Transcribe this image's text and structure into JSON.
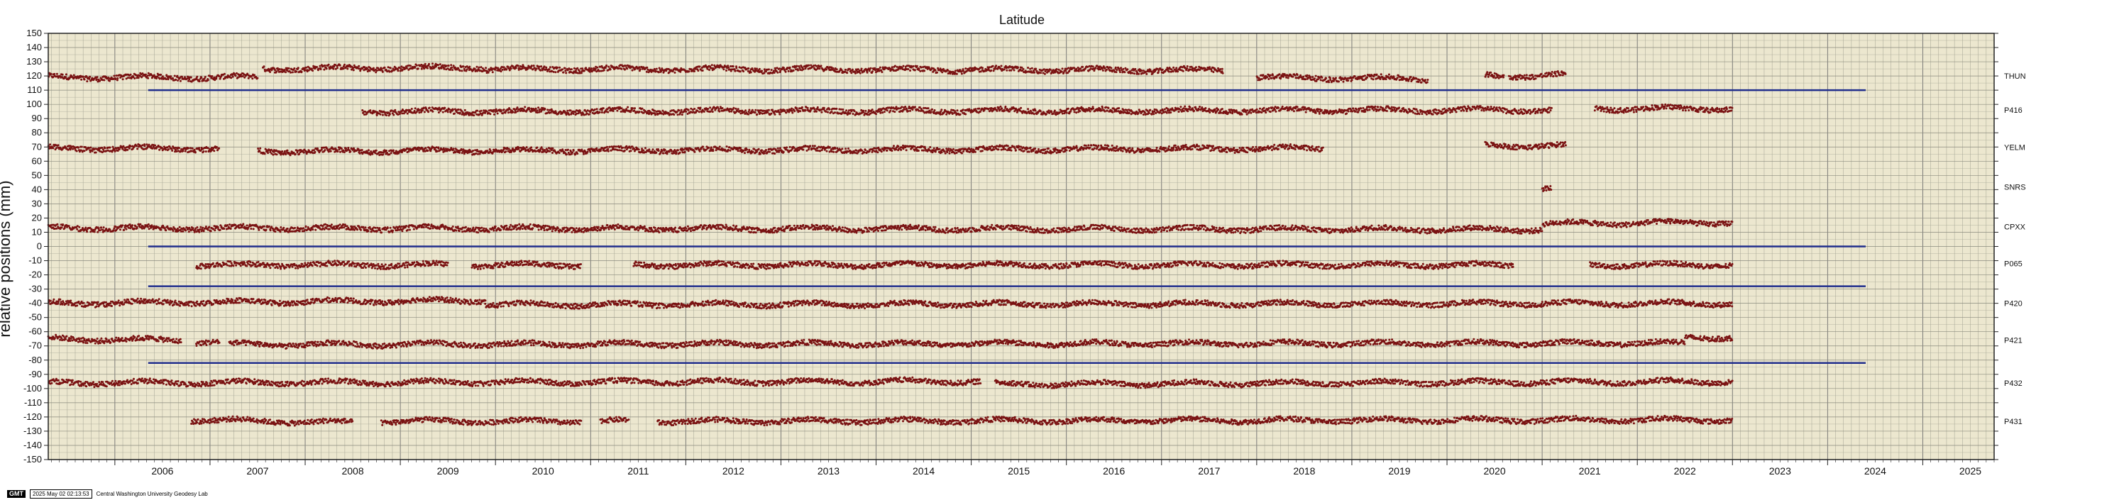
{
  "chart_data": {
    "type": "scatter",
    "title": "Latitude",
    "ylabel": "relative positions (mm)",
    "xlabel": "",
    "xlim": [
      2005.3,
      2025.75
    ],
    "ylim": [
      -150,
      150
    ],
    "y_ticks": [
      -150,
      -140,
      -130,
      -120,
      -110,
      -100,
      -90,
      -80,
      -70,
      -60,
      -50,
      -40,
      -30,
      -20,
      -10,
      0,
      10,
      20,
      30,
      40,
      50,
      60,
      70,
      80,
      90,
      100,
      110,
      120,
      130,
      140,
      150
    ],
    "x_ticks": [
      2006,
      2007,
      2008,
      2009,
      2010,
      2011,
      2012,
      2013,
      2014,
      2015,
      2016,
      2017,
      2018,
      2019,
      2020,
      2021,
      2022,
      2023,
      2024,
      2025
    ],
    "x_tick_labels": [
      "2006",
      "2007",
      "2008",
      "2009",
      "2010",
      "2011",
      "2012",
      "2013",
      "2014",
      "2015",
      "2016",
      "2017",
      "2018",
      "2019",
      "2020",
      "2021",
      "2022",
      "2023",
      "2024",
      "2025"
    ],
    "grid": true,
    "background": "#ece7cf",
    "point_color": "#7a1212",
    "ref_line_color": "#1f2d8c",
    "reference_lines": [
      {
        "y": 110,
        "x": [
          2006.35,
          2024.4
        ]
      },
      {
        "y": 0,
        "x": [
          2006.35,
          2024.4
        ]
      },
      {
        "y": -28,
        "x": [
          2006.35,
          2024.4
        ]
      },
      {
        "y": -82,
        "x": [
          2006.35,
          2024.4
        ]
      }
    ],
    "series": [
      {
        "name": "THUN",
        "offset": 120,
        "segments": [
          {
            "x": [
              2005.3,
              2007.5
            ],
            "y": [
              119,
              119
            ]
          },
          {
            "x": [
              2007.55,
              2009.9
            ],
            "y": [
              125,
              126
            ]
          },
          {
            "x": [
              2009.9,
              2017.65
            ],
            "y": [
              125,
              124
            ]
          },
          {
            "x": [
              2018.0,
              2019.8
            ],
            "y": [
              119,
              118
            ]
          },
          {
            "x": [
              2020.4,
              2020.6
            ],
            "y": [
              120,
              120
            ]
          },
          {
            "x": [
              2020.65,
              2021.25
            ],
            "y": [
              120,
              121
            ]
          }
        ]
      },
      {
        "name": "P416",
        "offset": 96,
        "segments": [
          {
            "x": [
              2008.6,
              2021.1
            ],
            "y": [
              95,
              96
            ]
          },
          {
            "x": [
              2021.55,
              2023.0
            ],
            "y": [
              97,
              97
            ]
          }
        ]
      },
      {
        "name": "YELM",
        "offset": 70,
        "segments": [
          {
            "x": [
              2005.3,
              2007.1
            ],
            "y": [
              69,
              69
            ]
          },
          {
            "x": [
              2007.5,
              2018.7
            ],
            "y": [
              67,
              69
            ]
          },
          {
            "x": [
              2020.4,
              2021.25
            ],
            "y": [
              71,
              71
            ]
          }
        ]
      },
      {
        "name": "SNRS",
        "offset": 42,
        "segments": [
          {
            "x": [
              2021.0,
              2021.1
            ],
            "y": [
              41,
              41
            ]
          }
        ]
      },
      {
        "name": "CPXX",
        "offset": 14,
        "segments": [
          {
            "x": [
              2005.3,
              2021.0
            ],
            "y": [
              13,
              12
            ]
          },
          {
            "x": [
              2021.0,
              2023.0
            ],
            "y": [
              16,
              17
            ]
          }
        ]
      },
      {
        "name": "P065",
        "offset": -12,
        "segments": [
          {
            "x": [
              2006.85,
              2009.5
            ],
            "y": [
              -13,
              -13
            ]
          },
          {
            "x": [
              2009.75,
              2010.9
            ],
            "y": [
              -13,
              -13
            ]
          },
          {
            "x": [
              2011.45,
              2020.7
            ],
            "y": [
              -13,
              -13
            ]
          },
          {
            "x": [
              2021.5,
              2023.0
            ],
            "y": [
              -13,
              -13
            ]
          }
        ]
      },
      {
        "name": "P420",
        "offset": -40,
        "segments": [
          {
            "x": [
              2005.3,
              2009.9
            ],
            "y": [
              -40,
              -38
            ]
          },
          {
            "x": [
              2009.9,
              2023.0
            ],
            "y": [
              -41,
              -40
            ]
          }
        ]
      },
      {
        "name": "P421",
        "offset": -66,
        "segments": [
          {
            "x": [
              2005.3,
              2006.7
            ],
            "y": [
              -65,
              -66
            ]
          },
          {
            "x": [
              2006.85,
              2007.1
            ],
            "y": [
              -67,
              -67
            ]
          },
          {
            "x": [
              2007.2,
              2022.5
            ],
            "y": [
              -69,
              -68
            ]
          },
          {
            "x": [
              2022.5,
              2023.0
            ],
            "y": [
              -64,
              -64
            ]
          }
        ]
      },
      {
        "name": "P432",
        "offset": -96,
        "segments": [
          {
            "x": [
              2005.3,
              2015.1
            ],
            "y": [
              -96,
              -95
            ]
          },
          {
            "x": [
              2015.25,
              2023.0
            ],
            "y": [
              -97,
              -95
            ]
          }
        ]
      },
      {
        "name": "P431",
        "offset": -123,
        "segments": [
          {
            "x": [
              2006.8,
              2008.5
            ],
            "y": [
              -122,
              -124
            ]
          },
          {
            "x": [
              2008.8,
              2010.9
            ],
            "y": [
              -123,
              -123
            ]
          },
          {
            "x": [
              2011.1,
              2011.4
            ],
            "y": [
              -123,
              -123
            ]
          },
          {
            "x": [
              2011.7,
              2023.0
            ],
            "y": [
              -123,
              -122
            ]
          }
        ]
      }
    ]
  },
  "footer": {
    "badge": "GMT",
    "timestamp": "2025 May 02 02:13:53",
    "credit": "Central Washington University Geodesy Lab"
  }
}
